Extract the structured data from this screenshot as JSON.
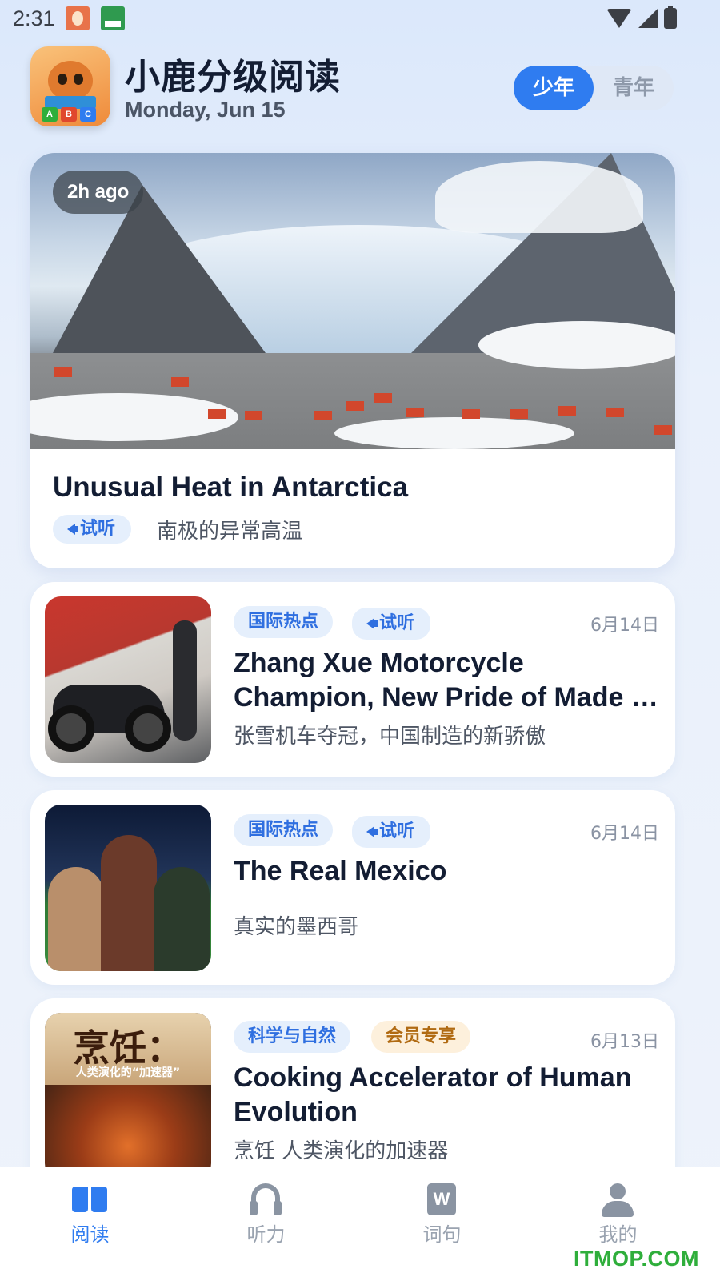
{
  "status_bar": {
    "time": "2:31"
  },
  "header": {
    "app_title": "小鹿分级阅读",
    "date": "Monday, Jun 15",
    "logo_letters": [
      "A",
      "B",
      "C"
    ],
    "level_options": [
      "少年",
      "青年"
    ],
    "selected_level": "少年"
  },
  "featured": {
    "time_ago": "2h ago",
    "title": "Unusual Heat in Antarctica",
    "listen_label": "试听",
    "subtitle": "南极的异常高温"
  },
  "articles": [
    {
      "tags": [
        "国际热点"
      ],
      "listen_label": "试听",
      "date": "6月14日",
      "title": "Zhang Xue Motorcycle Champion, New Pride of Made in China",
      "subtitle": "张雪机车夺冠，中国制造的新骄傲"
    },
    {
      "tags": [
        "国际热点"
      ],
      "listen_label": "试听",
      "date": "6月14日",
      "title": "The Real Mexico",
      "subtitle": "真实的墨西哥"
    },
    {
      "tags": [
        "科学与自然",
        "会员专享"
      ],
      "date": "6月13日",
      "title": "Cooking Accelerator of Human Evolution",
      "subtitle": "烹饪 人类演化的加速器",
      "thumb_title": "烹饪：",
      "thumb_subtitle": "人类演化的“加速器”"
    }
  ],
  "bottom_nav": {
    "items": [
      {
        "label": "阅读",
        "icon": "book-icon",
        "active": true
      },
      {
        "label": "听力",
        "icon": "headphones-icon",
        "active": false
      },
      {
        "label": "词句",
        "icon": "word-doc-icon",
        "active": false
      },
      {
        "label": "我的",
        "icon": "user-icon",
        "active": false
      }
    ]
  },
  "colors": {
    "accent": "#2f7cf0",
    "tag_blue_bg": "#e5effc",
    "tag_gold_bg": "#fdf0dc",
    "tag_gold_text": "#b06a12"
  },
  "watermark": "ITMOP.COM"
}
